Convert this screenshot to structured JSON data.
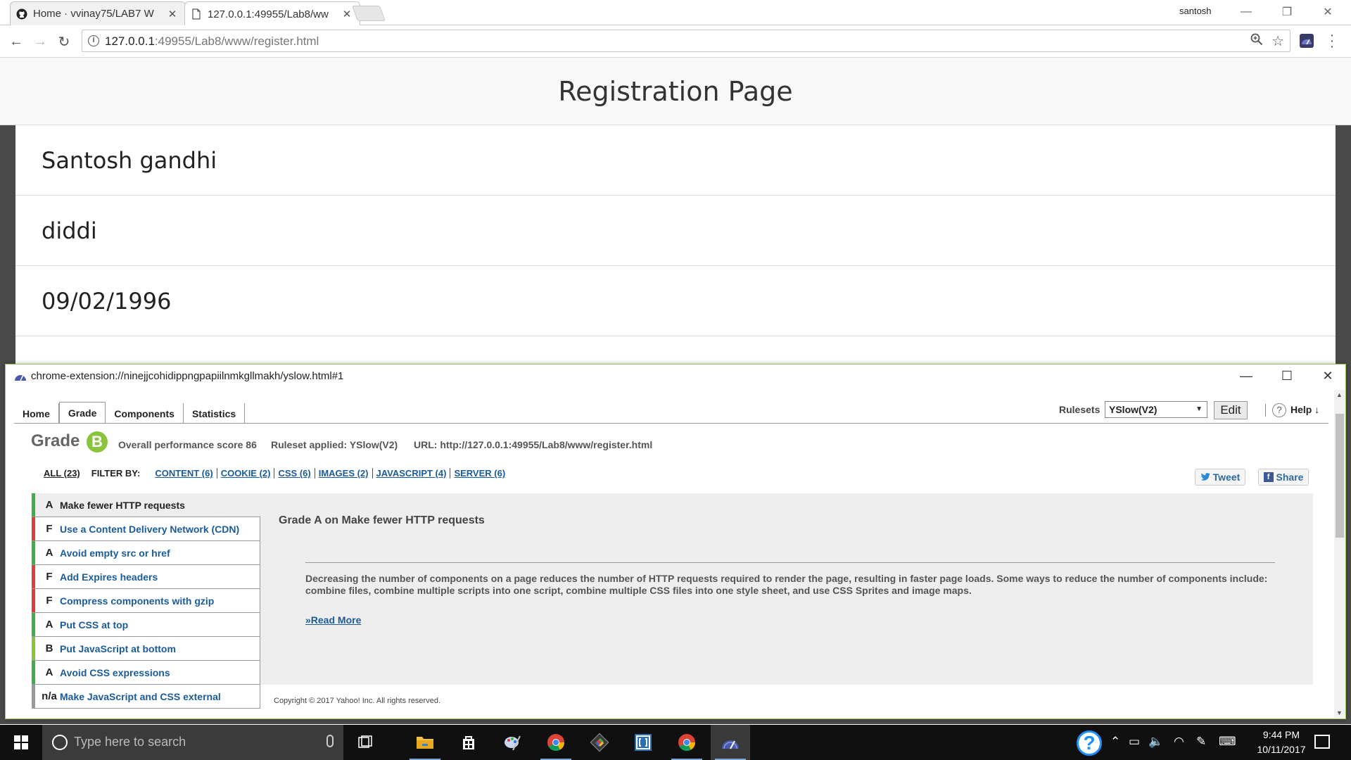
{
  "browser": {
    "tabs": [
      {
        "title": "Home · vvinay75/LAB7 W",
        "icon": "github-icon",
        "active": false
      },
      {
        "title": "127.0.0.1:49955/Lab8/ww",
        "icon": "page-icon",
        "active": true
      }
    ],
    "profile_name": "santosh",
    "url_host": "127.0.0.1",
    "url_rest": ":49955/Lab8/www/register.html"
  },
  "registration": {
    "title": "Registration Page",
    "fields": [
      "Santosh gandhi",
      "diddi",
      "09/02/1996"
    ]
  },
  "yslow": {
    "window_title": "chrome-extension://ninejjcohidippngpapiilnmkgllmakh/yslow.html#1",
    "tabs": [
      "Home",
      "Grade",
      "Components",
      "Statistics"
    ],
    "active_tab": "Grade",
    "rulesets_label": "Rulesets",
    "ruleset_selected": "YSlow(V2)",
    "edit_label": "Edit",
    "help_icon": "?",
    "help_label": "Help ↓",
    "grade_label": "Grade",
    "grade": "B",
    "grade_color": "#8ac43f",
    "overall_score": "Overall performance score 86",
    "ruleset_applied": "Ruleset applied: YSlow(V2)",
    "url": "URL: http://127.0.0.1:49955/Lab8/www/register.html",
    "filter": {
      "all": "ALL (23)",
      "filter_by": "FILTER BY:",
      "links": [
        "CONTENT (6)",
        "COOKIE (2)",
        "CSS (6)",
        "IMAGES (2)",
        "JAVASCRIPT (4)",
        "SERVER (6)"
      ]
    },
    "tweet_label": "Tweet",
    "share_label": "Share",
    "rules": [
      {
        "grade": "A",
        "name": "Make fewer HTTP requests",
        "color": "#3cb044"
      },
      {
        "grade": "F",
        "name": "Use a Content Delivery Network (CDN)",
        "color": "#e03c3c"
      },
      {
        "grade": "A",
        "name": "Avoid empty src or href",
        "color": "#3cb044"
      },
      {
        "grade": "F",
        "name": "Add Expires headers",
        "color": "#e03c3c"
      },
      {
        "grade": "F",
        "name": "Compress components with gzip",
        "color": "#e03c3c"
      },
      {
        "grade": "A",
        "name": "Put CSS at top",
        "color": "#3cb044"
      },
      {
        "grade": "B",
        "name": "Put JavaScript at bottom",
        "color": "#8ac43f"
      },
      {
        "grade": "A",
        "name": "Avoid CSS expressions",
        "color": "#3cb044"
      },
      {
        "grade": "n/a",
        "name": "Make JavaScript and CSS external",
        "color": "#999999"
      }
    ],
    "detail": {
      "title": "Grade A on Make fewer HTTP requests",
      "text": "Decreasing the number of components on a page reduces the number of HTTP requests required to render the page, resulting in faster page loads. Some ways to reduce the number of components include: combine files, combine multiple scripts into one script, combine multiple CSS files into one style sheet, and use CSS Sprites and image maps.",
      "read_more": "»Read More"
    },
    "copyright": "Copyright © 2017 Yahoo! Inc. All rights reserved."
  },
  "taskbar": {
    "search_placeholder": "Type here to search",
    "time": "9:44 PM",
    "date": "10/11/2017",
    "apps": [
      "task-view-icon",
      "file-explorer-icon",
      "store-icon",
      "paint-icon",
      "chrome-icon",
      "git-icon",
      "bracket-app-icon",
      "chrome-icon",
      "yslow-icon"
    ]
  }
}
